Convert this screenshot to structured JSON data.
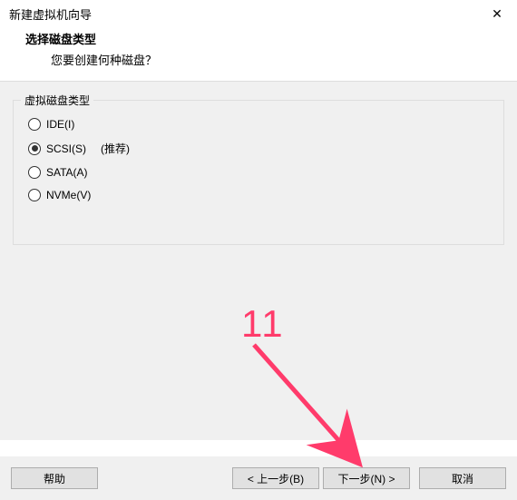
{
  "window": {
    "title": "新建虚拟机向导",
    "close_glyph": "✕"
  },
  "header": {
    "heading": "选择磁盘类型",
    "sub": "您要创建何种磁盘？"
  },
  "group": {
    "label": "虚拟磁盘类型",
    "options": [
      {
        "label": "IDE(I)",
        "checked": false,
        "recommend": ""
      },
      {
        "label": "SCSI(S)",
        "checked": true,
        "recommend": "(推荐)"
      },
      {
        "label": "SATA(A)",
        "checked": false,
        "recommend": ""
      },
      {
        "label": "NVMe(V)",
        "checked": false,
        "recommend": ""
      }
    ]
  },
  "buttons": {
    "help": "帮助",
    "back": "< 上一步(B)",
    "next": "下一步(N) >",
    "cancel": "取消"
  },
  "annotation": {
    "number": "11"
  }
}
